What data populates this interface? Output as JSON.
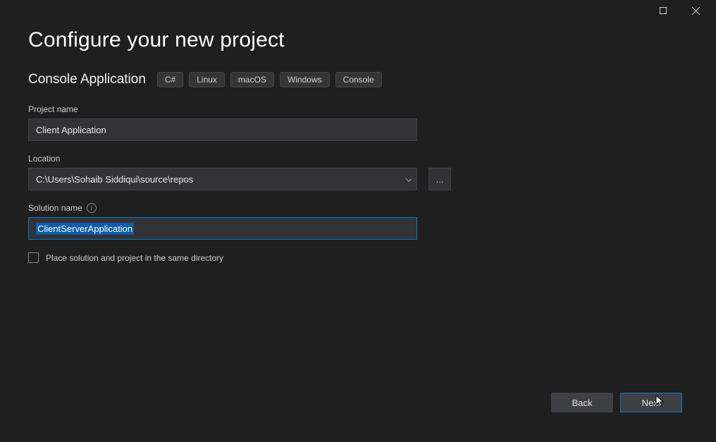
{
  "page_title": "Configure your new project",
  "template_name": "Console Application",
  "tags": [
    "C#",
    "Linux",
    "macOS",
    "Windows",
    "Console"
  ],
  "project_name": {
    "label": "Project name",
    "value": "Client Application"
  },
  "location": {
    "label": "Location",
    "value": "C:\\Users\\Sohaib Siddiqui\\source\\repos",
    "browse": "..."
  },
  "solution_name": {
    "label": "Solution name",
    "value": "ClientServerApplication"
  },
  "checkbox": {
    "label": "Place solution and project in the same directory",
    "checked": false
  },
  "buttons": {
    "back": "Back",
    "next": "Next"
  }
}
